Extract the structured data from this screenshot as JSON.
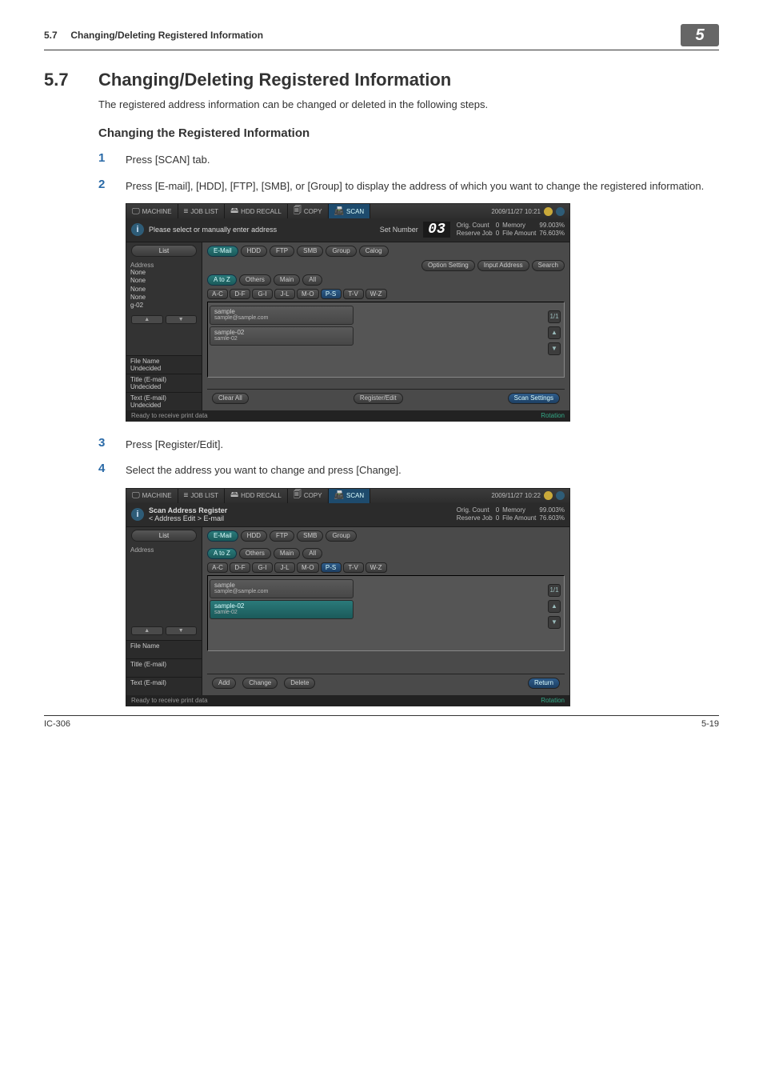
{
  "running_header": {
    "section_num": "5.7",
    "title": "Changing/Deleting Registered Information",
    "chapter_marker": "5"
  },
  "heading": {
    "num": "5.7",
    "title": "Changing/Deleting Registered Information"
  },
  "intro": "The registered address information can be changed or deleted in the following steps.",
  "subheading": "Changing the Registered Information",
  "steps": {
    "s1": {
      "num": "1",
      "text": "Press [SCAN] tab."
    },
    "s2": {
      "num": "2",
      "text": "Press [E-mail], [HDD], [FTP], [SMB], or [Group] to display the address of which you want to change the registered information."
    },
    "s3": {
      "num": "3",
      "text": "Press [Register/Edit]."
    },
    "s4": {
      "num": "4",
      "text": "Select the address you want to change and press [Change]."
    }
  },
  "screen_common": {
    "tabs": {
      "machine": "MACHINE",
      "joblist": "JOB LIST",
      "hddrecall": "HDD RECALL",
      "copy": "COPY",
      "scan": "SCAN"
    },
    "datetime": "2009/11/27 10:21",
    "datetime2": "2009/11/27 10:22",
    "status": {
      "orig_count_label": "Orig. Count",
      "orig_count_val": "0",
      "memory_label": "Memory",
      "memory_val": "99.003%",
      "reserve_label": "Reserve Job",
      "reserve_val": "0",
      "file_amount_label": "File Amount",
      "file_amount_val": "76.603%"
    },
    "set_number_label": "Set Number",
    "set_number_value": "03",
    "cat_tabs": {
      "email": "E-Mail",
      "hdd": "HDD",
      "ftp": "FTP",
      "smb": "SMB",
      "group": "Group",
      "calog": "Calog"
    },
    "right_tabs": {
      "option": "Option Setting",
      "input": "Input Address",
      "search": "Search"
    },
    "sort_tabs": {
      "atoz": "A to Z",
      "others": "Others",
      "main": "Main",
      "all": "All"
    },
    "letters": [
      "A-C",
      "D-F",
      "G-I",
      "J-L",
      "M-O",
      "P-S",
      "T-V",
      "W-Z"
    ],
    "entries": [
      {
        "name": "sample",
        "addr": "sample@sample.com"
      },
      {
        "name": "sample-02",
        "addr": "samle-02"
      }
    ],
    "side": {
      "list_btn": "List",
      "address_label": "Address",
      "nones": [
        "None",
        "None",
        "None",
        "None",
        "g-02"
      ],
      "file_name_label": "File Name",
      "undecided": "Undecided",
      "title_label": "Title (E-mail)",
      "text_label": "Text (E-mail)"
    },
    "foot": {
      "clear_all": "Clear All",
      "register_edit": "Register/Edit",
      "scan_settings": "Scan Settings",
      "add": "Add",
      "change": "Change",
      "delete": "Delete",
      "return": "Return"
    },
    "statusbar_msg": "Ready to receive print data",
    "rotation": "Rotation",
    "page_counter": "1/1"
  },
  "screen1_msg": "Please select or manually enter address",
  "screen2_msg_line1": "Scan Address Register",
  "screen2_msg_line2": "< Address Edit > E-mail",
  "footer": {
    "left": "IC-306",
    "right": "5-19"
  }
}
